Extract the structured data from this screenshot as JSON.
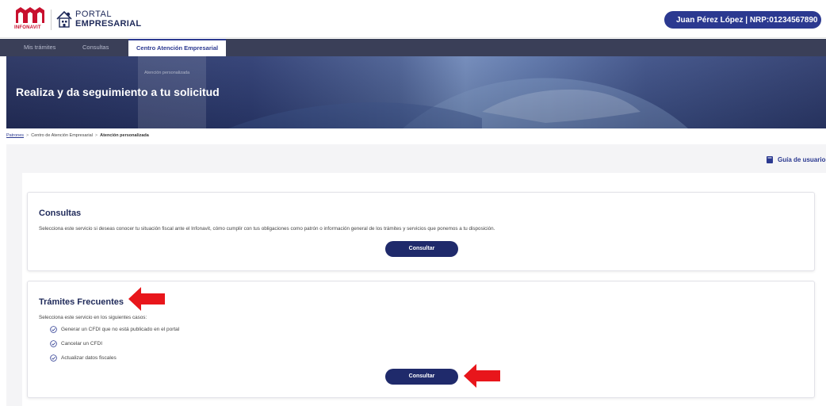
{
  "header": {
    "infonavit_logo_text": "INFONAVIT",
    "portal_line1": "PORTAL",
    "portal_line2": "EMPRESARIAL",
    "user_label": "Juan Pérez López  | NRP:01234567890"
  },
  "nav": {
    "tabs": [
      {
        "label": "Mis trámites"
      },
      {
        "label": "Consultas"
      },
      {
        "label": "Centro Atención Empresarial"
      }
    ]
  },
  "hero": {
    "title": "Realiza y da seguimiento a tu solicitud",
    "dropdown_hint": "Atención personalizada"
  },
  "breadcrumb": {
    "items": [
      "Patrones",
      "Centro de Atención Empresarial",
      "Atención personalizada"
    ],
    "separator": ">"
  },
  "guide": {
    "label": "Guía de usuario"
  },
  "cards": [
    {
      "title": "Consultas",
      "description": "Selecciona este servicio si deseas conocer tu situación fiscal ante el Infonavit, cómo cumplir con tus obligaciones como patrón o información general de los trámites y servicios que ponemos a tu disposición.",
      "button": "Consultar"
    },
    {
      "title": "Trámites Frecuentes",
      "description": "Selecciona este servicio en los siguientes casos:",
      "items": [
        "Generar un CFDI que no está publicado en el portal",
        "Cancelar un CFDI",
        "Actualizar datos fiscales"
      ],
      "button": "Consultar"
    }
  ],
  "colors": {
    "brand_navy": "#1f2a6b",
    "accent_blue": "#2b3990",
    "annotation_red": "#e8161b"
  }
}
